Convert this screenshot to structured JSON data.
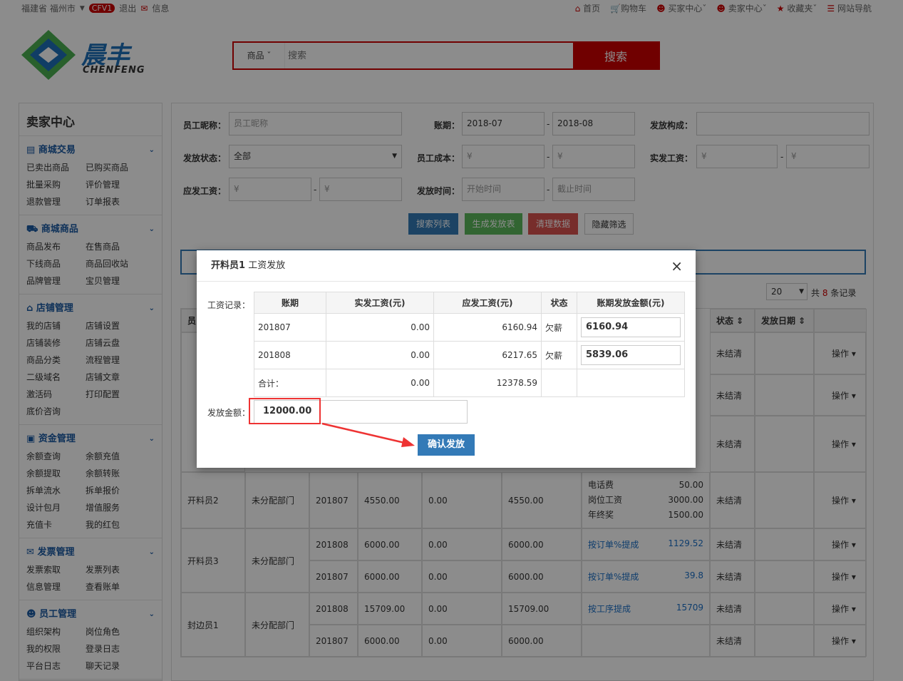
{
  "top": {
    "location": "福建省 福州市",
    "badge": "CFV1",
    "logout": "退出",
    "msg": "信息",
    "home": "首页",
    "cart": "购物车",
    "buyer": "买家中心",
    "seller": "卖家中心",
    "fav": "收藏夹",
    "nav": "网站导航"
  },
  "logo": {
    "cn": "晨丰",
    "en": "CHENFENG"
  },
  "search": {
    "category": "商品",
    "placeholder": "搜索",
    "button": "搜索"
  },
  "sidebar": {
    "title": "卖家中心",
    "groups": [
      {
        "title": "商城交易",
        "icon": "list-icon",
        "items": [
          "已卖出商品",
          "已购买商品",
          "批量采购",
          "评价管理",
          "退款管理",
          "订单报表"
        ]
      },
      {
        "title": "商城商品",
        "icon": "truck-icon",
        "items": [
          "商品发布",
          "在售商品",
          "下线商品",
          "商品回收站",
          "品牌管理",
          "宝贝管理"
        ]
      },
      {
        "title": "店铺管理",
        "icon": "home-icon",
        "items": [
          "我的店铺",
          "店铺设置",
          "店铺装修",
          "店铺云盘",
          "商品分类",
          "流程管理",
          "二级域名",
          "店铺文章",
          "激活码",
          "打印配置",
          "底价咨询"
        ]
      },
      {
        "title": "资金管理",
        "icon": "money-icon",
        "items": [
          "余额查询",
          "余额充值",
          "余额提取",
          "余额转账",
          "拆单流水",
          "拆单报价",
          "设计包月",
          "增值服务",
          "充值卡",
          "我的红包"
        ]
      },
      {
        "title": "发票管理",
        "icon": "envelope-icon",
        "items": [
          "发票索取",
          "发票列表",
          "信息管理",
          "查看账单"
        ]
      },
      {
        "title": "员工管理",
        "icon": "users-icon",
        "items": [
          "组织架构",
          "岗位角色",
          "我的权限",
          "登录日志",
          "平台日志",
          "聊天记录"
        ]
      }
    ]
  },
  "filters": {
    "nickname_label": "员工昵称：",
    "nickname_ph": "员工昵称",
    "period_label": "账期：",
    "period_from": "2018-07",
    "period_to": "2018-08",
    "compose_label": "发放构成：",
    "status_label": "发放状态：",
    "status_val": "全部",
    "cost_label": "员工成本：",
    "actual_label": "实发工资：",
    "due_label": "应发工资：",
    "time_label": "发放时间：",
    "time_from": "开始时间",
    "time_to": "截止时间",
    "yen": "¥",
    "dash": "-"
  },
  "actions": {
    "search": "搜索列表",
    "generate": "生成发放表",
    "clear": "清理数据",
    "hide": "隐藏筛选"
  },
  "paging": {
    "size": "20",
    "total_pre": "共",
    "total": "8",
    "total_post": "条记录"
  },
  "table": {
    "headers": [
      "员",
      "状态",
      "发放日期"
    ],
    "op": "操作",
    "status": "未结清",
    "rows": [
      {
        "name": "开料员2",
        "dept": "未分配部门",
        "period": "201807",
        "a": "4550.00",
        "b": "0.00",
        "c": "4550.00",
        "items": [
          [
            "电话费",
            "50.00"
          ],
          [
            "岗位工资",
            "3000.00"
          ],
          [
            "年终奖",
            "1500.00"
          ]
        ]
      },
      {
        "name": "开料员3",
        "dept": "未分配部门",
        "period": "201808",
        "a": "6000.00",
        "b": "0.00",
        "c": "6000.00",
        "link": "按订单%提成",
        "lv": "1129.52"
      },
      {
        "name": "",
        "dept": "",
        "period": "201807",
        "a": "6000.00",
        "b": "0.00",
        "c": "6000.00",
        "link": "按订单%提成",
        "lv": "39.8"
      },
      {
        "name": "封边员1",
        "dept": "未分配部门",
        "period": "201808",
        "a": "15709.00",
        "b": "0.00",
        "c": "15709.00",
        "link": "按工序提成",
        "lv": "15709"
      },
      {
        "name": "",
        "dept": "",
        "period": "201807",
        "a": "6000.00",
        "b": "0.00",
        "c": "6000.00"
      }
    ]
  },
  "modal": {
    "title_bold": "开料员1",
    "title": "工资发放",
    "rec_label": "工资记录：",
    "cols": [
      "账期",
      "实发工资(元)",
      "应发工资(元)",
      "状态",
      "账期发放金额(元)"
    ],
    "rows": [
      {
        "p": "201807",
        "a": "0.00",
        "d": "6160.94",
        "s": "欠薪",
        "v": "6160.94"
      },
      {
        "p": "201808",
        "a": "0.00",
        "d": "6217.65",
        "s": "欠薪",
        "v": "5839.06"
      }
    ],
    "sum_label": "合计：",
    "sum_a": "0.00",
    "sum_d": "12378.59",
    "amount_label": "发放金额：",
    "amount": "12000.00",
    "confirm": "确认发放"
  }
}
